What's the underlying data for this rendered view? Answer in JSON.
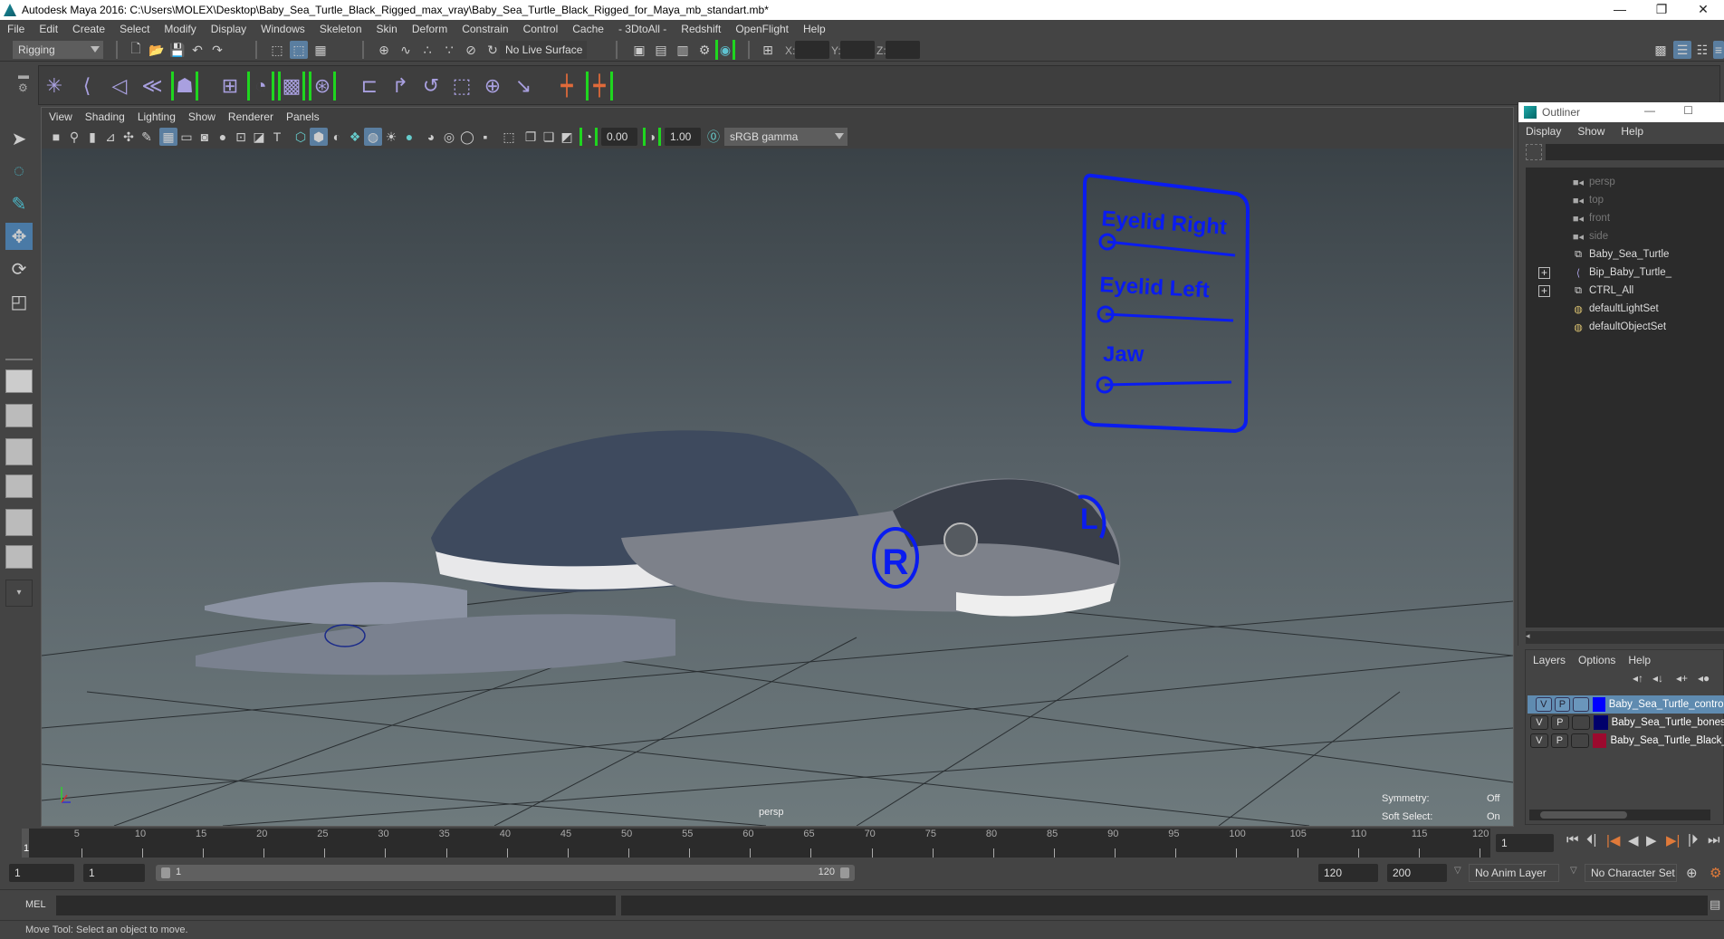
{
  "window": {
    "title": "Autodesk Maya 2016: C:\\Users\\MOLEX\\Desktop\\Baby_Sea_Turtle_Black_Rigged_max_vray\\Baby_Sea_Turtle_Black_Rigged_for_Maya_mb_standart.mb*",
    "minimize": "—",
    "restore": "❐",
    "close": "✕"
  },
  "menubar": [
    "File",
    "Edit",
    "Create",
    "Select",
    "Modify",
    "Display",
    "Windows",
    "Skeleton",
    "Skin",
    "Deform",
    "Constrain",
    "Control",
    "Cache",
    "- 3DtoAll -",
    "Redshift",
    "OpenFlight",
    "Help"
  ],
  "statusline": {
    "mode": "Rigging",
    "live_surface": "No Live Surface",
    "x_label": "X:",
    "y_label": "Y:",
    "z_label": "Z:",
    "x_value": "",
    "y_value": "",
    "z_value": ""
  },
  "viewport": {
    "menu": [
      "View",
      "Shading",
      "Lighting",
      "Show",
      "Renderer",
      "Panels"
    ],
    "exposure": "0.00",
    "gamma": "1.00",
    "color_space": "sRGB gamma",
    "camera_label": "persp",
    "hud": {
      "symmetry_label": "Symmetry:",
      "symmetry_value": "Off",
      "soft_select_label": "Soft Select:",
      "soft_select_value": "On"
    },
    "controls_board": {
      "labels": [
        "Eyelid Right",
        "Eyelid Left",
        "Jaw"
      ]
    },
    "eye_controls": [
      "R",
      "L"
    ]
  },
  "outliner": {
    "title": "Outliner",
    "menu": [
      "Display",
      "Show",
      "Help"
    ],
    "items": [
      {
        "label": "persp",
        "icon": "camera-icon",
        "dim": true,
        "expandable": false
      },
      {
        "label": "top",
        "icon": "camera-icon",
        "dim": true,
        "expandable": false
      },
      {
        "label": "front",
        "icon": "camera-icon",
        "dim": true,
        "expandable": false
      },
      {
        "label": "side",
        "icon": "camera-icon",
        "dim": true,
        "expandable": false
      },
      {
        "label": "Baby_Sea_Turtle",
        "icon": "mesh-icon",
        "dim": false,
        "expandable": false
      },
      {
        "label": "Bip_Baby_Turtle_",
        "icon": "joint-icon",
        "dim": false,
        "expandable": true
      },
      {
        "label": "CTRL_All",
        "icon": "mesh-icon",
        "dim": false,
        "expandable": true
      },
      {
        "label": "defaultLightSet",
        "icon": "set-icon",
        "dim": false,
        "expandable": false
      },
      {
        "label": "defaultObjectSet",
        "icon": "set-icon",
        "dim": false,
        "expandable": false
      }
    ]
  },
  "layers": {
    "menu": [
      "Layers",
      "Options",
      "Help"
    ],
    "rows": [
      {
        "v": "V",
        "p": "P",
        "color": "#0000ff",
        "name": "Baby_Sea_Turtle_controllers",
        "selected": true
      },
      {
        "v": "V",
        "p": "P",
        "color": "#00006b",
        "name": "Baby_Sea_Turtle_bones",
        "selected": false
      },
      {
        "v": "V",
        "p": "P",
        "color": "#9c0a2e",
        "name": "Baby_Sea_Turtle_Black_",
        "selected": false
      }
    ]
  },
  "timeline": {
    "ticks": [
      "5",
      "10",
      "15",
      "20",
      "25",
      "30",
      "35",
      "40",
      "45",
      "50",
      "55",
      "60",
      "65",
      "70",
      "75",
      "80",
      "85",
      "90",
      "95",
      "100",
      "105",
      "110",
      "115",
      "120"
    ],
    "current_frame_marker": "1",
    "current_frame": "1",
    "start_min": 1,
    "end_max": 120
  },
  "range": {
    "start": "1",
    "playback_start": "1",
    "slider_start": "1",
    "slider_end": "120",
    "playback_end": "120",
    "anim_end": "200",
    "anim_layer": "No Anim Layer",
    "character_set": "No Character Set"
  },
  "mel": {
    "label": "MEL"
  },
  "help_line": "Move Tool: Select an object to move."
}
